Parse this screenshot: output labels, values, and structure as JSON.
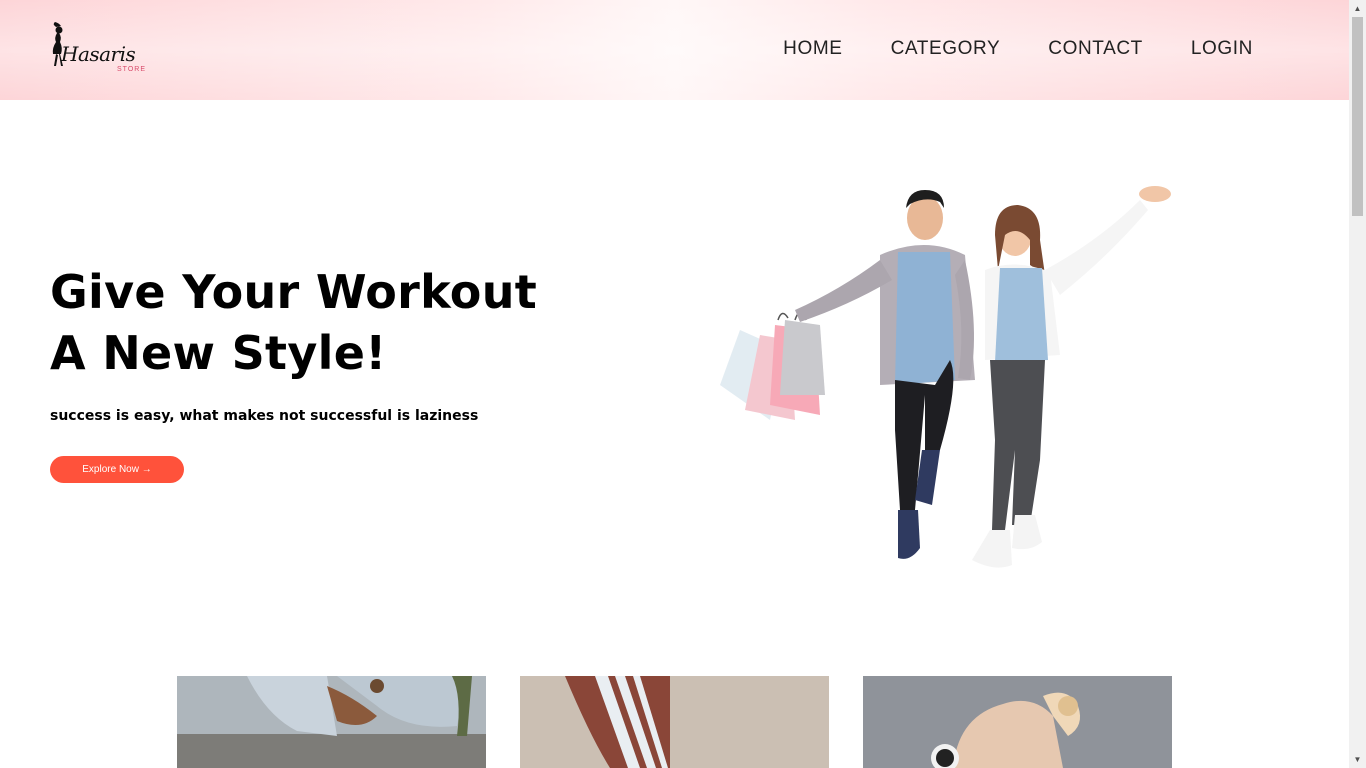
{
  "brand": {
    "logo_text": "Hasaris",
    "logo_sub": "STORE",
    "accent_color": "#ff523b"
  },
  "nav": {
    "items": [
      {
        "label": "HOME"
      },
      {
        "label": "CATEGORY"
      },
      {
        "label": "CONTACT"
      },
      {
        "label": "LOGIN"
      }
    ]
  },
  "hero": {
    "title_line1": "Give Your Workout",
    "title_line2": "A New Style!",
    "subtitle": "success is easy, what makes not successful is laziness",
    "cta_label": "Explore Now →",
    "image_icon": "couple-shopping-image"
  },
  "categories": [
    {
      "icon": "jeans-photo"
    },
    {
      "icon": "track-pants-photo"
    },
    {
      "icon": "smartwatch-photo"
    }
  ]
}
